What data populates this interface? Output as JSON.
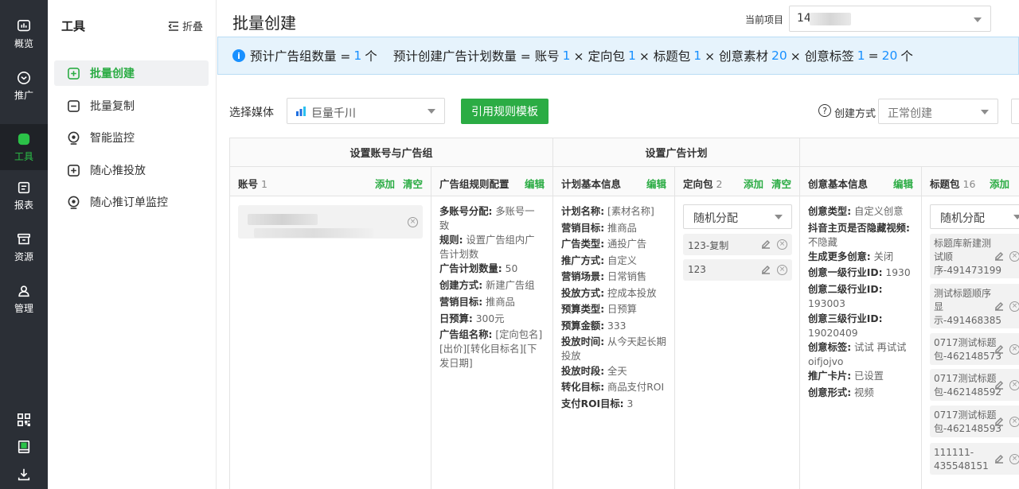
{
  "rail": {
    "items": [
      {
        "label": "概览",
        "icon": "overview-icon"
      },
      {
        "label": "推广",
        "icon": "promote-icon"
      },
      {
        "label": "工具",
        "icon": "tools-icon"
      },
      {
        "label": "报表",
        "icon": "report-icon"
      },
      {
        "label": "资源",
        "icon": "resource-icon"
      },
      {
        "label": "管理",
        "icon": "manage-icon"
      }
    ],
    "bottom_icons": [
      "qrcode-icon",
      "book-icon",
      "download-icon"
    ]
  },
  "submenu": {
    "title": "工具",
    "collapse_label": "折叠",
    "items": [
      "批量创建",
      "批量复制",
      "智能监控",
      "随心推投放",
      "随心推订单监控"
    ]
  },
  "header": {
    "title": "批量创建",
    "project_label": "当前项目",
    "project_value": "14"
  },
  "banner": {
    "p1": "预计广告组数量 =",
    "n1": "1",
    "p2": "个",
    "p3": "预计创建广告计划数量 = 账号",
    "n2": "1",
    "p4": "× 定向包",
    "n3": "1",
    "p5": "× 标题包",
    "n4": "1",
    "p6": "× 创意素材",
    "n5": "20",
    "p7": "× 创意标签",
    "n6": "1",
    "p8": "=",
    "n7": "20",
    "p9": "个"
  },
  "toolbar": {
    "media_label": "选择媒体",
    "media_value": "巨量千川",
    "rule_button": "引用规则模板",
    "mode_label": "创建方式",
    "mode_value": "正常创建"
  },
  "table": {
    "groups": [
      "设置账号与广告组",
      "设置广告计划"
    ],
    "columns": {
      "account": {
        "title": "账号",
        "count": "1",
        "add": "添加",
        "clear": "清空"
      },
      "adgroup_rule": {
        "title": "广告组规则配置",
        "edit": "编辑"
      },
      "plan_info": {
        "title": "计划基本信息",
        "edit": "编辑"
      },
      "targeting": {
        "title": "定向包",
        "count": "2",
        "add": "添加",
        "clear": "清空"
      },
      "creative_info": {
        "title": "创意基本信息",
        "edit": "编辑"
      },
      "title_pack": {
        "title": "标题包",
        "count": "16",
        "add": "添加"
      }
    },
    "adgroup_rule_lines": [
      {
        "k": "多账号分配:",
        "v": "多账号一致"
      },
      {
        "k": "规则:",
        "v": "设置广告组内广告计划数"
      },
      {
        "k": "广告计划数量:",
        "v": "50"
      },
      {
        "k": "创建方式:",
        "v": "新建广告组"
      },
      {
        "k": "营销目标:",
        "v": "推商品"
      },
      {
        "k": "日预算:",
        "v": "300元"
      },
      {
        "k": "广告组名称:",
        "v": "[定向包名][出价][转化目标名][下发日期]"
      }
    ],
    "plan_lines": [
      {
        "k": "计划名称:",
        "v": "[素材名称]"
      },
      {
        "k": "营销目标:",
        "v": "推商品"
      },
      {
        "k": "广告类型:",
        "v": "通投广告"
      },
      {
        "k": "推广方式:",
        "v": "自定义"
      },
      {
        "k": "营销场景:",
        "v": "日常销售"
      },
      {
        "k": "投放方式:",
        "v": "控成本投放"
      },
      {
        "k": "预算类型:",
        "v": "日预算"
      },
      {
        "k": "预算金额:",
        "v": "333"
      },
      {
        "k": "投放时间:",
        "v": "从今天起长期投放"
      },
      {
        "k": "投放时段:",
        "v": "全天"
      },
      {
        "k": "转化目标:",
        "v": "商品支付ROI"
      },
      {
        "k": "支付ROI目标:",
        "v": "3"
      }
    ],
    "targeting_select": "随机分配",
    "targeting_items": [
      "123-复制",
      "123"
    ],
    "creative_lines": [
      {
        "k": "创意类型:",
        "v": "自定义创意"
      },
      {
        "k": "抖音主页是否隐藏视频:",
        "v": "不隐藏"
      },
      {
        "k": "生成更多创意:",
        "v": "关闭"
      },
      {
        "k": "创意一级行业ID:",
        "v": "1930"
      },
      {
        "k": "创意二级行业ID:",
        "v": "193003"
      },
      {
        "k": "创意三级行业ID:",
        "v": "19020409"
      },
      {
        "k": "创意标签:",
        "v": "试试 再试试oifjojvo"
      },
      {
        "k": "推广卡片:",
        "v": "已设置"
      },
      {
        "k": "创意形式:",
        "v": "视频"
      }
    ],
    "title_select": "随机分配",
    "title_items": [
      "标题库新建测试顺序-491473199",
      "测试标题顺序显示-491468385",
      "0717测试标题包-462148573",
      "0717测试标题包-462148592",
      "0717测试标题包-462148593",
      "111111-435548151"
    ]
  },
  "colors": {
    "accent": "#2bac44",
    "info": "#1890ff",
    "rail": "#2b2f36"
  }
}
